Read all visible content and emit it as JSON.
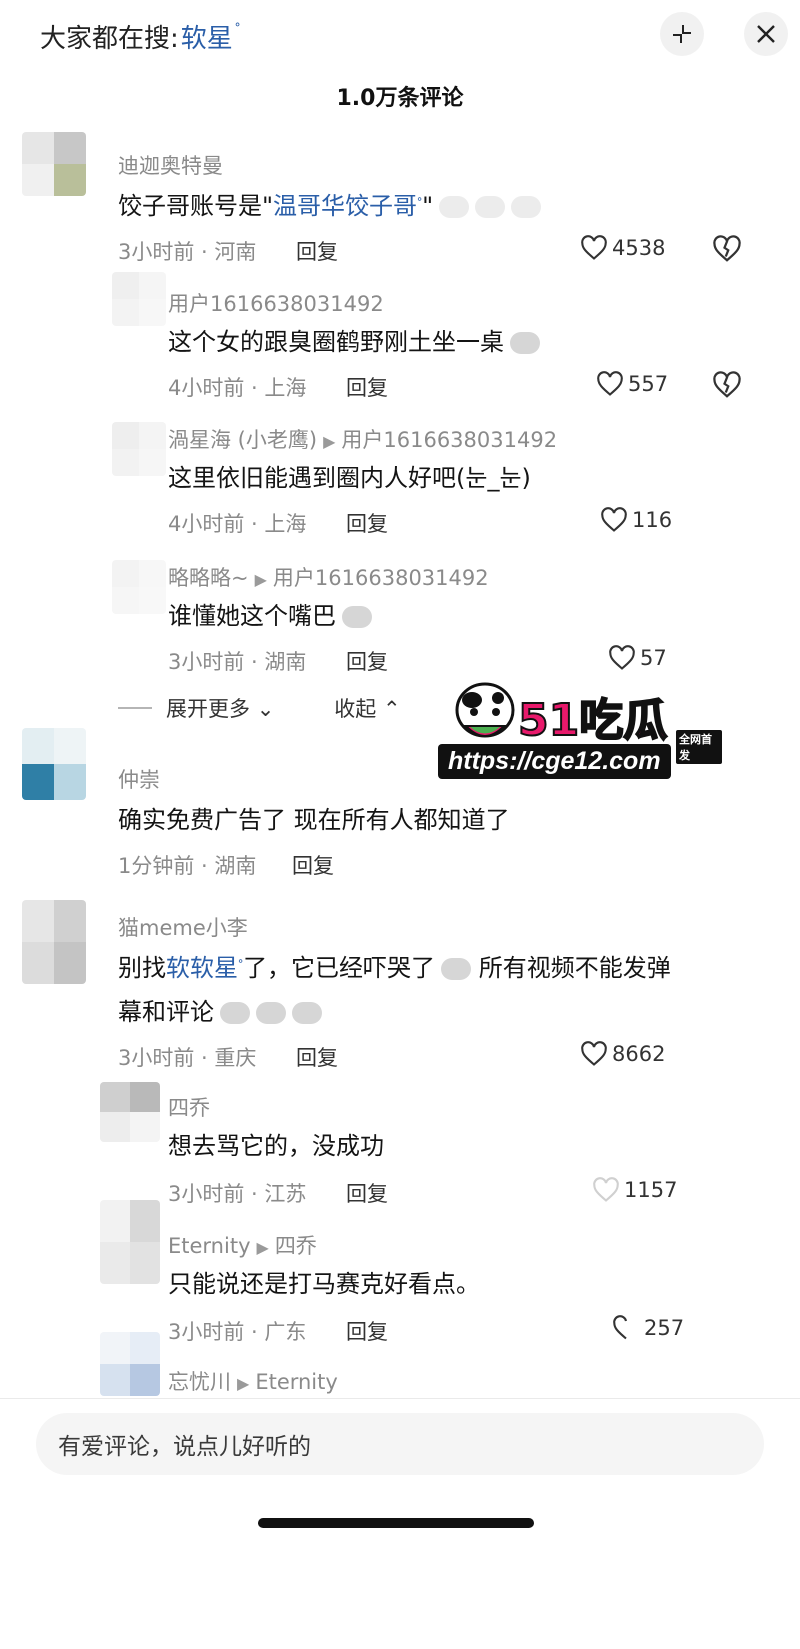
{
  "header": {
    "search_prefix": "大家都在搜:",
    "search_keyword": "软星",
    "comment_count": "1.0万条评论"
  },
  "colors": {
    "link": "#2a5ea8",
    "text": "#141414",
    "meta": "#8a8a8a"
  },
  "icons": {
    "collapse": "collapse-icon",
    "close": "close-icon",
    "like": "heart-icon",
    "dislike": "broken-heart-icon"
  },
  "comments": [
    {
      "user": "迪迦奥特曼",
      "text_pre": "饺子哥账号是\"",
      "keyword": "温哥华饺子哥",
      "text_post": "\"",
      "time_location": "3小时前 · 河南",
      "reply": "回复",
      "likes": "4538"
    },
    {
      "user": "用户1616638031492",
      "text": "这个女的跟臭圈鹤野刚土坐一桌",
      "time_location": "4小时前 · 上海",
      "reply": "回复",
      "likes": "557"
    },
    {
      "user": "渦星海 (小老鹰)",
      "reply_to": "用户1616638031492",
      "text": "这里依旧能遇到圈内人好吧(눈_눈)",
      "time_location": "4小时前 · 上海",
      "reply": "回复",
      "likes": "116"
    },
    {
      "user": "略略略~",
      "reply_to": "用户1616638031492",
      "text": "谁懂她这个嘴巴",
      "time_location": "3小时前 · 湖南",
      "reply": "回复",
      "likes": "57"
    },
    {
      "user": "仲崇",
      "text": "确实免费广告了  现在所有人都知道了",
      "time_location": "1分钟前 · 湖南",
      "reply": "回复"
    },
    {
      "user": "猫meme小李",
      "text_pre": "别找",
      "keyword": "软软星",
      "text_post": "了，它已经吓哭了",
      "text_post2": "所有视频不能发弹",
      "text_line2": "幕和评论",
      "time_location": "3小时前 · 重庆",
      "reply": "回复",
      "likes": "8662"
    },
    {
      "user": "四乔",
      "text": "想去骂它的，没成功",
      "time_location": "3小时前 · 江苏",
      "reply": "回复",
      "likes": "1157"
    },
    {
      "user": "Eternity",
      "reply_to": "四乔",
      "text": "只能说还是打马赛克好看点。",
      "time_location": "3小时前 · 广东",
      "reply": "回复",
      "likes": "257"
    },
    {
      "user": "忘忧川",
      "reply_to": "Eternity"
    }
  ],
  "expand": {
    "more": "展开更多",
    "collapse": "收起"
  },
  "watermark": {
    "logo": "51吃瓜",
    "url": "https://cge12.com",
    "tag": "全网首发"
  },
  "input": {
    "placeholder": "有爱评论，说点儿好听的"
  }
}
